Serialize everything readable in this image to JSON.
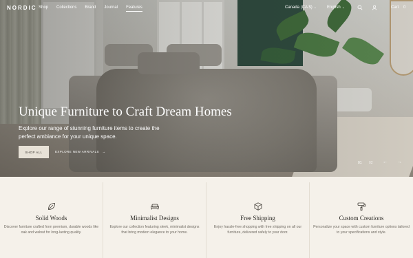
{
  "brand": "NORDIC",
  "nav": {
    "links": [
      "Shop",
      "Collections",
      "Brand",
      "Journal",
      "Features"
    ],
    "active_index": 4,
    "country": "Canada (CA $)",
    "language": "English",
    "cart_label": "Cart",
    "cart_count": "0",
    "icons": [
      "search-icon",
      "user-icon"
    ]
  },
  "hero": {
    "title": "Unique Furniture to Craft Dream Homes",
    "description": "Explore our range of stunning furniture items to create the perfect ambiance for your unique space.",
    "primary_cta": "SHOP ALL",
    "secondary_cta": "EXPLORE NEW ARRIVALS",
    "secondary_arrow": "→",
    "pager": [
      "01",
      "02"
    ],
    "prev_arrow": "←",
    "next_arrow": "→"
  },
  "features": [
    {
      "icon": "leaf-icon",
      "title": "Solid Woods",
      "description": "Discover furniture crafted from premium, durable woods like oak and walnut for long-lasting quality."
    },
    {
      "icon": "sofa-icon",
      "title": "Minimalist Designs",
      "description": "Explore our collection featuring sleek, minimalist designs that bring modern elegance to your home."
    },
    {
      "icon": "box-icon",
      "title": "Free Shipping",
      "description": "Enjoy hassle-free shopping with free shipping on all our furniture, delivered safely to your door."
    },
    {
      "icon": "paint-roller-icon",
      "title": "Custom Creations",
      "description": "Personalize your space with custom furniture options tailored to your specifications and style."
    }
  ],
  "colors": {
    "accent_button": "#e8e2d7",
    "page_bg": "#f5f1ea",
    "text_dark": "#2c2a26"
  }
}
